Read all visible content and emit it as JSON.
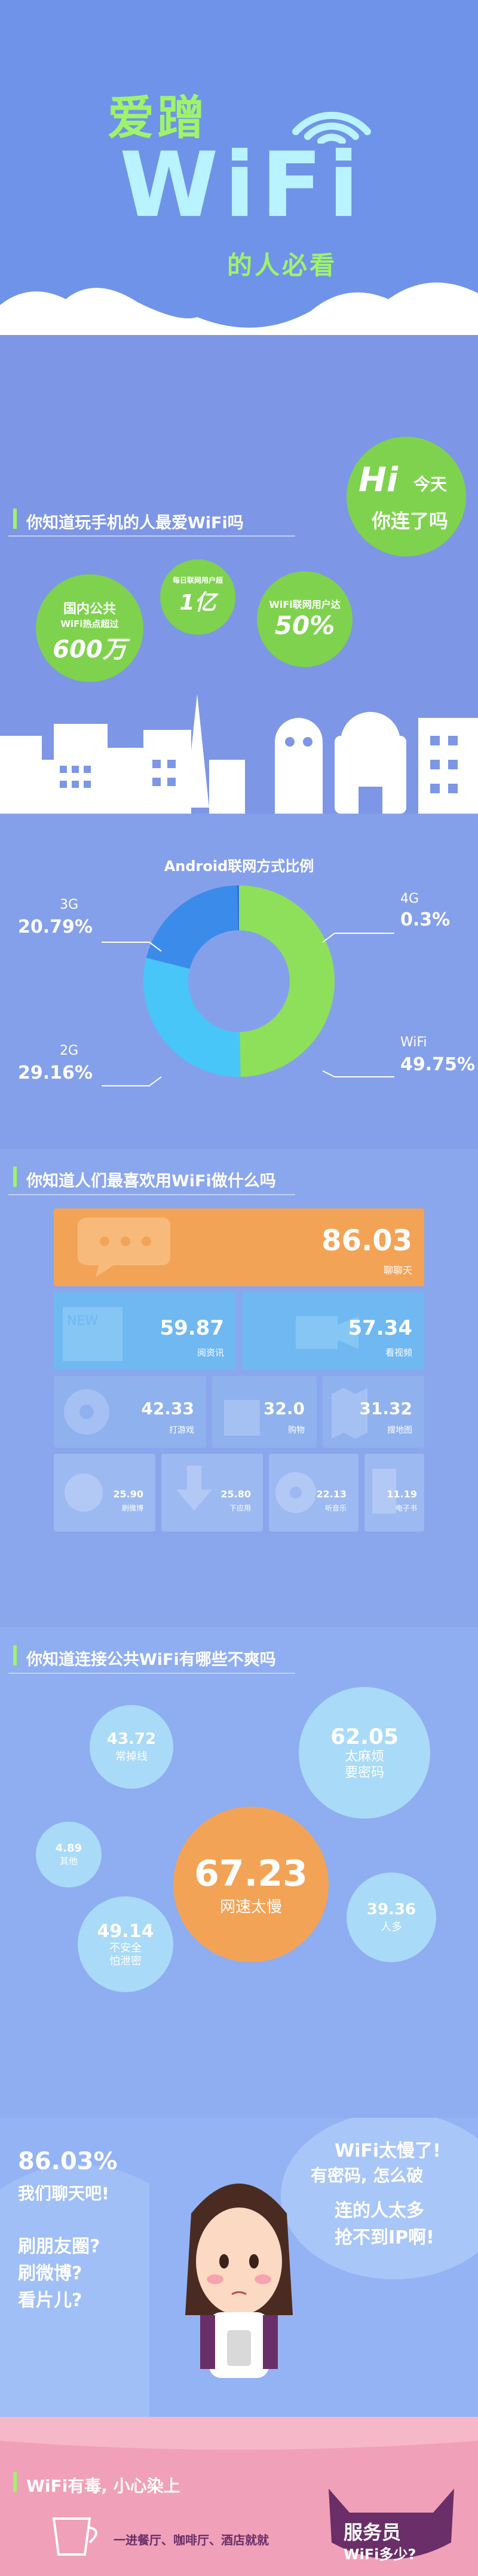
{
  "hero": {
    "line1": "爱蹭",
    "line2": "WiFi",
    "line3": "的人必看"
  },
  "section1": {
    "title": "你知道玩手机的人最爱WiFi吗",
    "hi": {
      "hi": "Hi",
      "today": "今天",
      "connected": "你连了吗"
    },
    "bubbles": [
      {
        "l1": "国内公共",
        "l2": "WiFi热点超过",
        "big": "600万"
      },
      {
        "l1": "每日联网用户超",
        "big": "1亿"
      },
      {
        "l1": "WiFi联网用户达",
        "big": "50%"
      }
    ]
  },
  "section2": {
    "title": "Android联网方式比例",
    "chart_data": {
      "type": "pie",
      "title": "Android联网方式比例",
      "categories": [
        "WiFi",
        "2G",
        "3G",
        "4G"
      ],
      "values": [
        49.75,
        29.16,
        20.79,
        0.3
      ],
      "labels": [
        "49.75%",
        "29.16%",
        "20.79%",
        "0.3%"
      ],
      "colors": [
        "#8ee05a",
        "#47c6f7",
        "#3b8bea",
        "#2a6fd0"
      ]
    }
  },
  "section3": {
    "title": "你知道人们最喜欢用WiFi做什么吗",
    "tiles": [
      {
        "value": "86.03",
        "label": "聊聊天",
        "icon": "chat-icon"
      },
      {
        "value": "59.87",
        "label": "阅资讯",
        "icon": "news-icon"
      },
      {
        "value": "57.34",
        "label": "看视频",
        "icon": "video-icon"
      },
      {
        "value": "42.33",
        "label": "打游戏",
        "icon": "game-icon"
      },
      {
        "value": "32.0",
        "label": "购物",
        "icon": "shopping-icon"
      },
      {
        "value": "31.32",
        "label": "搜地图",
        "icon": "map-icon"
      },
      {
        "value": "25.90",
        "label": "刷微博",
        "icon": "weibo-icon"
      },
      {
        "value": "25.80",
        "label": "下应用",
        "icon": "download-icon"
      },
      {
        "value": "22.13",
        "label": "听音乐",
        "icon": "music-icon"
      },
      {
        "value": "11.19",
        "label": "电子书",
        "icon": "ebook-icon"
      }
    ]
  },
  "section4": {
    "title": "你知道连接公共WiFi有哪些不爽吗",
    "items": [
      {
        "value": "43.72",
        "label": "常掉线"
      },
      {
        "value": "62.05",
        "label": "太麻烦\n要密码"
      },
      {
        "value": "4.89",
        "label": "其他"
      },
      {
        "value": "67.23",
        "label": "网速太慢"
      },
      {
        "value": "49.14",
        "label": "不安全\n怕泄密"
      },
      {
        "value": "39.36",
        "label": "人多"
      }
    ]
  },
  "section5": {
    "pct": "86.03%",
    "chat": "我们聊天吧!",
    "q1": "刷朋友圈?",
    "q2": "刷微博?",
    "q3": "看片儿?",
    "bubble_lines": [
      "WiFi太慢了!",
      "有密码, 怎么破",
      "连的人太多",
      "抢不到IP啊!"
    ]
  },
  "footer": {
    "title": "WiFi有毒, 小心染上",
    "places": "一进餐厅、咖啡厅、酒店就就",
    "badge1": "服务员",
    "badge2": "WiFi多少?"
  },
  "colors": {
    "green": "#8ee05a",
    "sky": "#b9f3ff",
    "orange": "#f3a356",
    "pink": "#f0a0b8"
  }
}
